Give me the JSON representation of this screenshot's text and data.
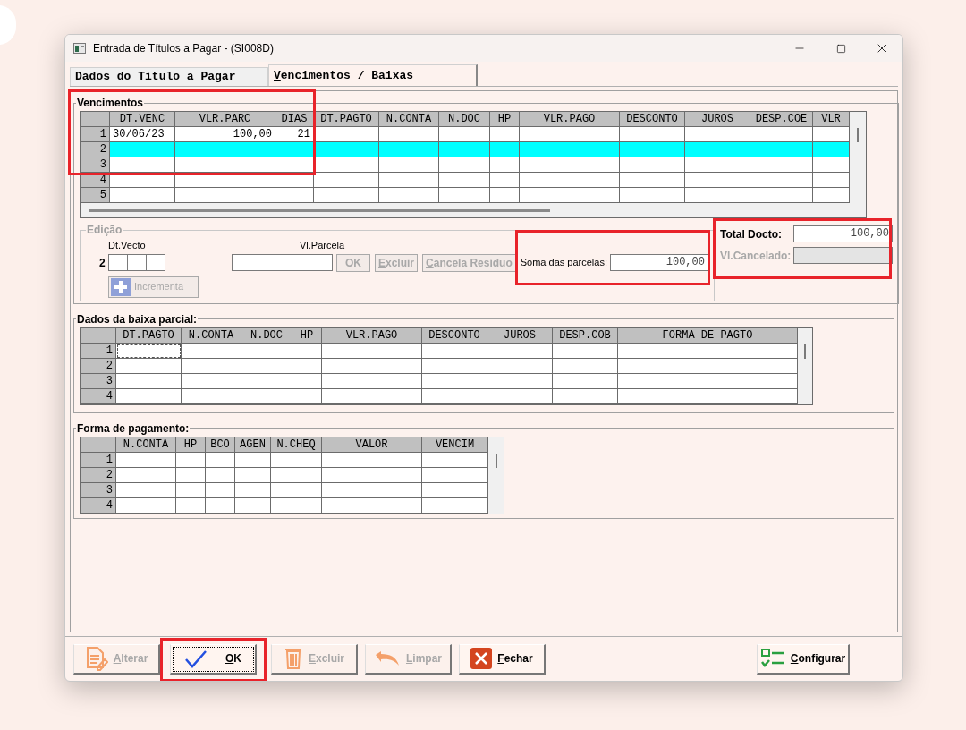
{
  "window": {
    "title": "Entrada de Títulos a Pagar - (SI008D)"
  },
  "tabs": [
    {
      "label": "Dados do Título a Pagar",
      "accel": true,
      "selected": false
    },
    {
      "label": "Vencimentos / Baixas",
      "accel": true,
      "selected": true
    }
  ],
  "vencimentos": {
    "title": "Vencimentos",
    "highlighted": true,
    "grid": {
      "columns": [
        "DT.VENC",
        "VLR.PARC",
        "DIAS",
        "DT.PAGTO",
        "N.CONTA",
        "N.DOC",
        "HP",
        "VLR.PAGO",
        "DESCONTO",
        "JUROS",
        "DESP.COE",
        "VLR"
      ],
      "rows": [
        {
          "n": "1",
          "cells": [
            "30/06/23",
            "100,00",
            "21"
          ],
          "selected": false
        },
        {
          "n": "2",
          "cells": [],
          "selected": true
        },
        {
          "n": "3",
          "cells": [],
          "selected": false
        },
        {
          "n": "4",
          "cells": [],
          "selected": false
        },
        {
          "n": "5",
          "cells": [],
          "selected": false
        }
      ]
    }
  },
  "edicao": {
    "title": "Edição",
    "dt_vecto_label": "Dt.Vecto",
    "row_number": "2",
    "vl_parcela_label": "Vl.Parcela",
    "buttons": [
      {
        "label": "OK",
        "accel": false,
        "disabled": true
      },
      {
        "label": "Excluir",
        "accel": true,
        "disabled": true
      },
      {
        "label": "Cancela Resíduo",
        "accel": true,
        "disabled": true
      }
    ],
    "incrementa": {
      "label": "Incrementa",
      "disabled": true
    },
    "soma": {
      "label": "Soma das parcelas:",
      "value": "100,00",
      "highlighted": true
    }
  },
  "totals": {
    "highlighted": true,
    "total_label": "Total Docto:",
    "total_value": "100,00",
    "cancelado_label": "Vl.Cancelado:",
    "cancelado_disabled": true
  },
  "baixa_parcial": {
    "title": "Dados da baixa parcial:",
    "grid": {
      "columns": [
        "DT.PAGTO",
        "N.CONTA",
        "N.DOC",
        "HP",
        "VLR.PAGO",
        "DESCONTO",
        "JUROS",
        "DESP.COB",
        "FORMA DE PAGTO"
      ],
      "rows": [
        {
          "n": "1",
          "cells": [],
          "selected": false,
          "focused": true
        },
        {
          "n": "2",
          "cells": [],
          "selected": false,
          "focused": false
        },
        {
          "n": "3",
          "cells": [],
          "selected": false,
          "focused": false
        },
        {
          "n": "4",
          "cells": [],
          "selected": false,
          "focused": false
        }
      ]
    }
  },
  "forma_pagamento": {
    "title": "Forma de pagamento:",
    "grid": {
      "columns": [
        "N.CONTA",
        "HP",
        "BCO",
        "AGEN",
        "N.CHEQ",
        "VALOR",
        "VENCIM"
      ],
      "rows": [
        {
          "n": "1",
          "cells": [],
          "selected": false
        },
        {
          "n": "2",
          "cells": [],
          "selected": false
        },
        {
          "n": "3",
          "cells": [],
          "selected": false
        },
        {
          "n": "4",
          "cells": [],
          "selected": false
        }
      ]
    }
  },
  "buttons": [
    {
      "kind": "edit",
      "label": "Alterar",
      "accel": true,
      "disabled": true,
      "focused": false,
      "highlighted": false
    },
    {
      "kind": "check",
      "label": "OK",
      "accel": true,
      "disabled": false,
      "focused": true,
      "highlighted": true
    },
    {
      "kind": "trash",
      "label": "Excluir",
      "accel": true,
      "disabled": true,
      "focused": false,
      "highlighted": false
    },
    {
      "kind": "undo",
      "label": "Limpar",
      "accel": true,
      "disabled": true,
      "focused": false,
      "highlighted": false
    },
    {
      "kind": "close",
      "label": "Fechar",
      "accel": true,
      "disabled": false,
      "focused": false,
      "highlighted": false
    },
    {
      "kind": "settings",
      "label": "Configurar",
      "accel": true,
      "disabled": false,
      "focused": false,
      "highlighted": false
    }
  ]
}
